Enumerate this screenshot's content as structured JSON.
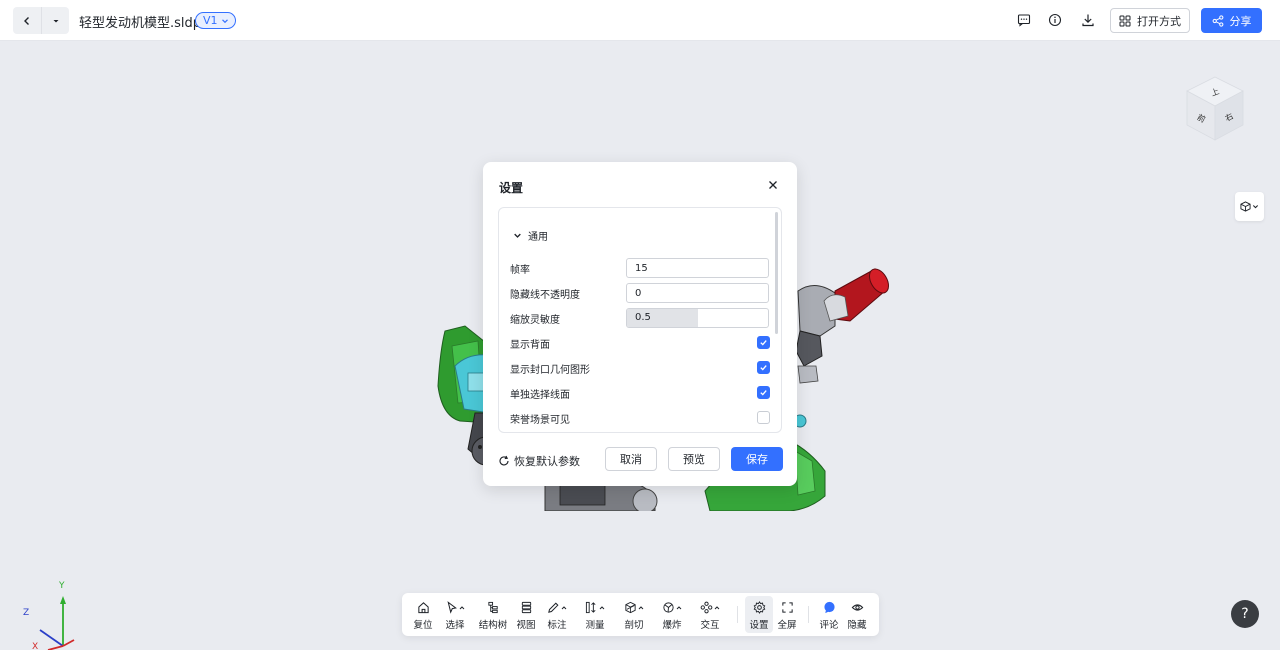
{
  "header": {
    "file_name": "轻型发动机模型.sldprt",
    "version": "V1",
    "open_with_label": "打开方式",
    "share_label": "分享"
  },
  "settings_dialog": {
    "title": "设置",
    "section": "通用",
    "frame_rate": {
      "label": "帧率",
      "value": "15"
    },
    "hidden_line_opacity": {
      "label": "隐藏线不透明度",
      "value": "0"
    },
    "zoom_sensitivity": {
      "label": "缩放灵敏度",
      "value": "0.5",
      "fraction": 0.5
    },
    "show_back_face": {
      "label": "显示背面",
      "checked": true
    },
    "show_capping": {
      "label": "显示封口几何图形",
      "checked": true
    },
    "select_edges": {
      "label": "单独选择线面",
      "checked": true
    },
    "honor_scene": {
      "label": "荣誉场景可见",
      "checked": false
    },
    "reset_label": "恢复默认参数",
    "cancel_label": "取消",
    "preview_label": "预览",
    "save_label": "保存"
  },
  "toolbar": {
    "reset": "复位",
    "select": "选择",
    "tree": "结构树",
    "view": "视图",
    "markup": "标注",
    "measure": "测量",
    "section": "剖切",
    "explode": "爆炸",
    "interact": "交互",
    "settings": "设置",
    "fullscreen": "全屏",
    "comment": "评论",
    "hide": "隐藏"
  },
  "viewport": {
    "navcube_faces": [
      "上",
      "前",
      "右"
    ],
    "axes": [
      "Y",
      "Z",
      "X"
    ],
    "help": "?"
  },
  "colors": {
    "accent": "#3370ff",
    "background": "#e9ebf0"
  }
}
